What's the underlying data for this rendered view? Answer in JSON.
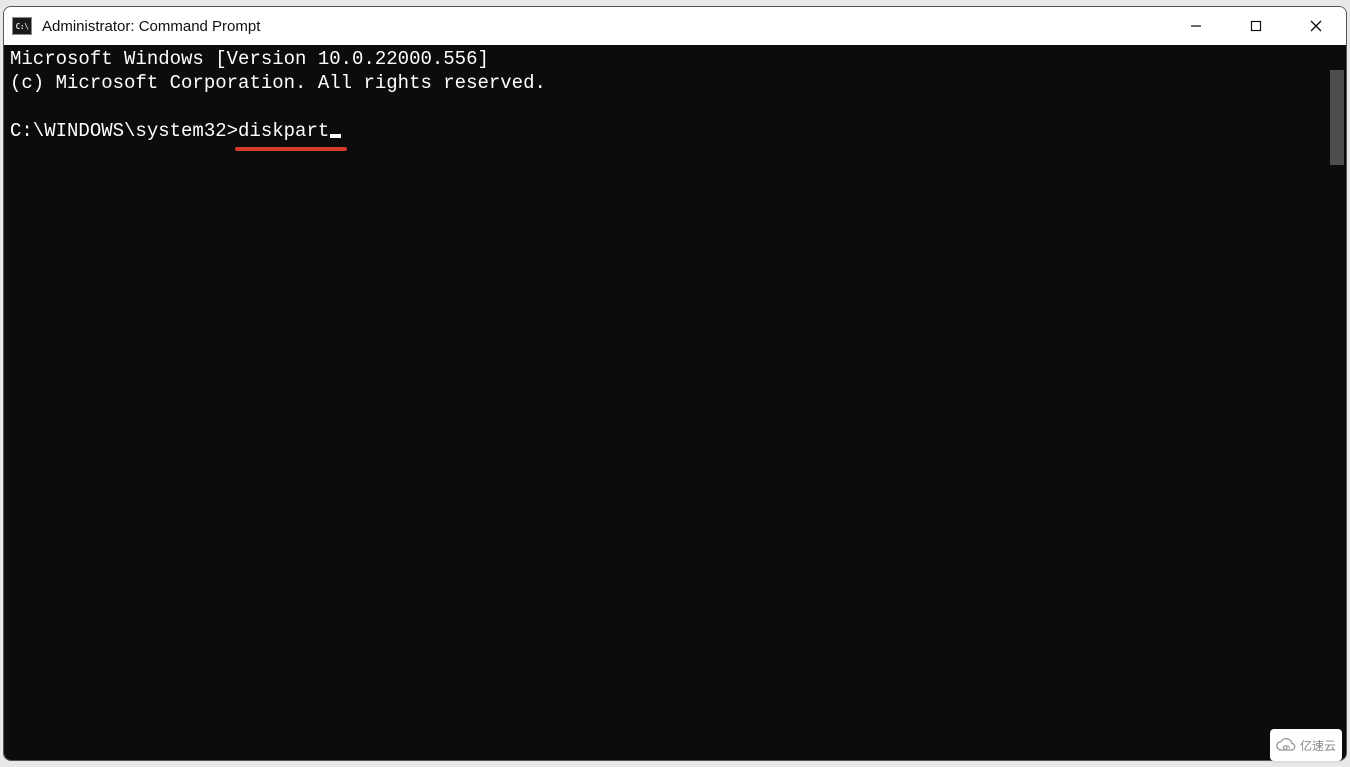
{
  "window": {
    "icon_label": "C:\\",
    "title": "Administrator: Command Prompt"
  },
  "terminal": {
    "line1": "Microsoft Windows [Version 10.0.22000.556]",
    "line2": "(c) Microsoft Corporation. All rights reserved.",
    "prompt": "C:\\WINDOWS\\system32>",
    "command": "diskpart",
    "annotation_color": "#d43a2a"
  },
  "watermark": {
    "text": "亿速云"
  }
}
